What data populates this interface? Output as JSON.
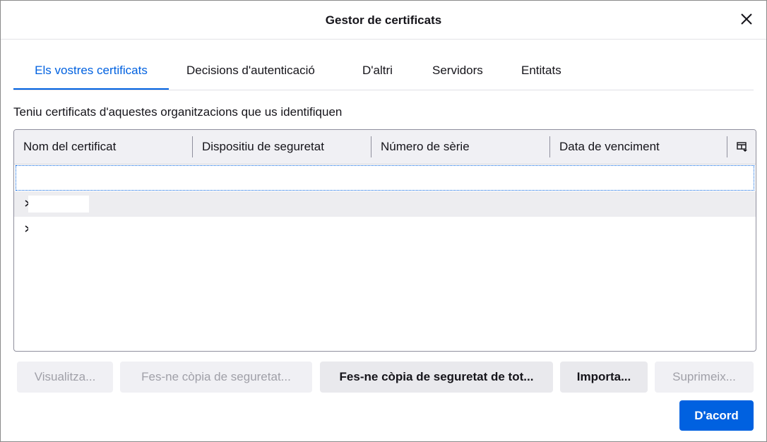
{
  "dialog": {
    "title": "Gestor de certificats"
  },
  "tabs": [
    {
      "label": "Els vostres certificats",
      "active": true
    },
    {
      "label": "Decisions d'autenticació",
      "active": false
    },
    {
      "label": "D'altri",
      "active": false
    },
    {
      "label": "Servidors",
      "active": false
    },
    {
      "label": "Entitats",
      "active": false
    }
  ],
  "intro_text": "Teniu certificats d'aquestes organitzacions que us identifiquen",
  "tree": {
    "columns": [
      "Nom del certificat",
      "Dispositiu de seguretat",
      "Número de sèrie",
      "Data de venciment"
    ],
    "column_picker_icon": "column-picker-icon",
    "rows": [
      {
        "label": "",
        "expandable": false,
        "focused": true
      },
      {
        "label": "",
        "expandable": true,
        "focused": false
      },
      {
        "label": "",
        "expandable": true,
        "focused": false
      }
    ]
  },
  "buttons": {
    "view": "Visualitza...",
    "backup": "Fes-ne còpia de seguretat...",
    "backup_all": "Fes-ne còpia de seguretat de tot...",
    "import": "Importa...",
    "delete": "Suprimeix...",
    "ok": "D'acord"
  },
  "colors": {
    "accent": "#0061e0",
    "disabled_text": "#a0a0a8",
    "button_bg": "#e9e9ed"
  }
}
